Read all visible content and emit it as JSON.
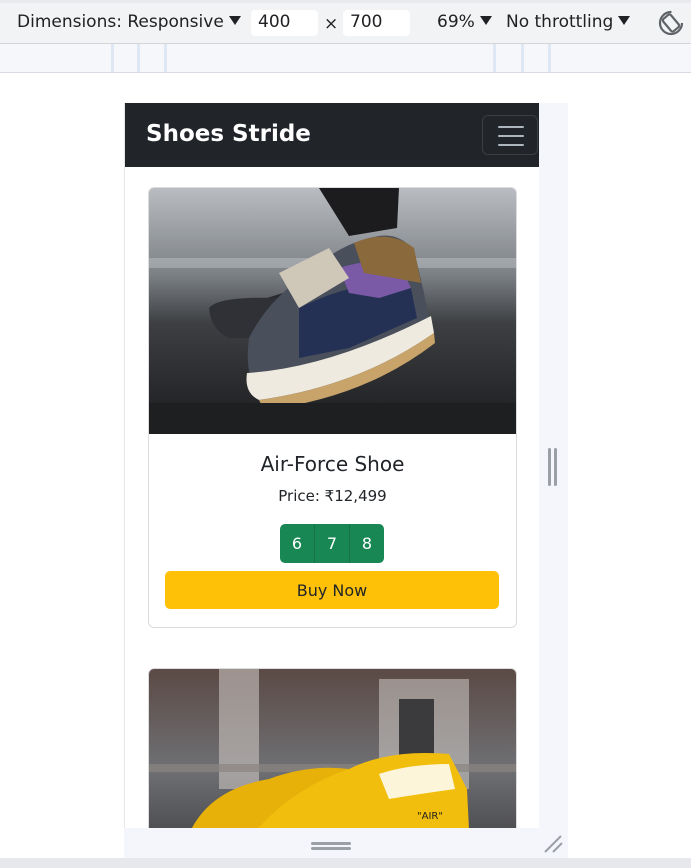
{
  "devtools": {
    "dimensions_label": "Dimensions: Responsive",
    "width_value": "400",
    "separator": "×",
    "height_value": "700",
    "zoom": "69%",
    "throttling": "No throttling",
    "rotate_icon": "rotate-icon"
  },
  "site": {
    "brand": "Shoes Stride",
    "menu_icon": "hamburger-menu-icon",
    "navbar_color": "#212529"
  },
  "products": [
    {
      "title": "Air-Force Shoe",
      "price": "Price: ₹12,499",
      "sizes": [
        "6",
        "7",
        "8"
      ],
      "buy_label": "Buy Now"
    }
  ],
  "colors": {
    "size_button": "#198754",
    "buy_button": "#ffc107"
  }
}
